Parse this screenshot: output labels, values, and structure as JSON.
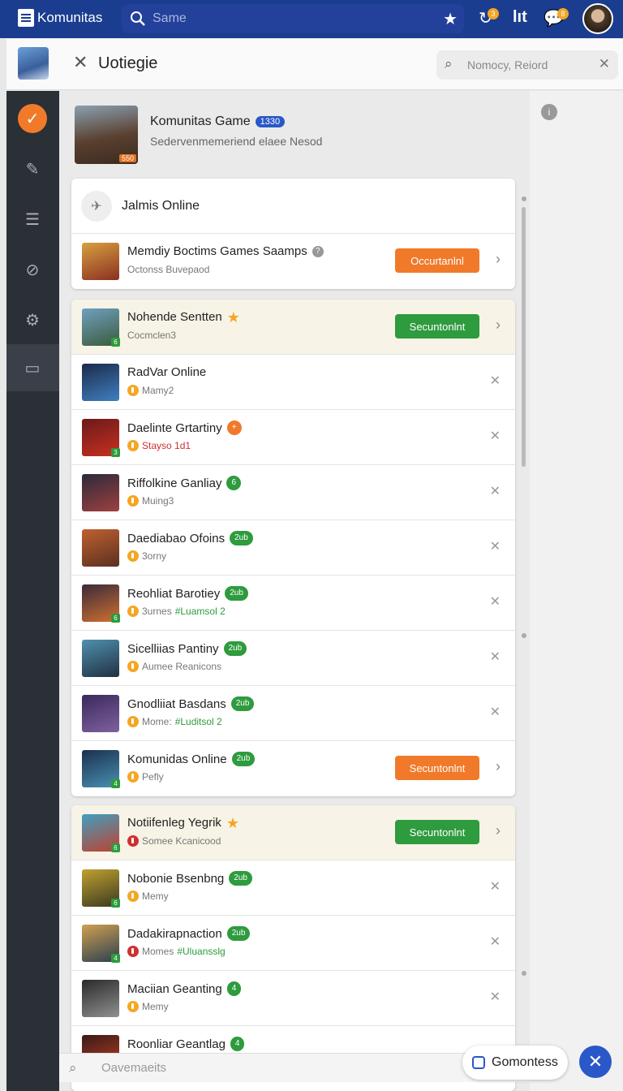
{
  "topbar": {
    "brand": "Komunitas",
    "search_placeholder": "Same",
    "badge1": "3",
    "badge2": "8"
  },
  "subbar": {
    "title": "Uotiegie",
    "search_placeholder": "Nomocy, Reiord"
  },
  "header_game": {
    "title": "Komunitas Game",
    "pill": "1330",
    "subtitle": "Sedervenmemeriend elaee Nesod",
    "num": "550"
  },
  "card1": {
    "header": "Jalmis Online",
    "rows": [
      {
        "title": "Memdiy Boctims Games Saamps",
        "sub": "Octonss Buvepaod",
        "action": "Occurtanlnl",
        "colors": [
          "#d8a040",
          "#8a3020"
        ]
      }
    ]
  },
  "card2": {
    "rows": [
      {
        "title": "Nohende Sentten",
        "tag": "★",
        "tagtype": "star",
        "sub": "Cocmclen3",
        "action": "Secuntonlnt",
        "actiontype": "g",
        "mini": "6",
        "colors": [
          "#70a0c0",
          "#3a5a3a"
        ]
      },
      {
        "title": "RadVar Online",
        "sub": "Mamy2",
        "coin": "o",
        "colors": [
          "#1a2a4a",
          "#4080c0"
        ]
      },
      {
        "title": "Daelinte Grtartiny",
        "tag": "+",
        "tagtype": "o",
        "sub": "Stayso 1d1",
        "subclass": "red",
        "coin": "o",
        "mini": "3",
        "colors": [
          "#6a1a1a",
          "#c83020"
        ]
      },
      {
        "title": "Riffolkine Ganliay",
        "tag": "6",
        "tagtype": "g",
        "sub": "Muing3",
        "coin": "o",
        "colors": [
          "#2a2a3a",
          "#a04040"
        ]
      },
      {
        "title": "Daediabao Ofoins",
        "tag": "2ub",
        "tagtype": "g",
        "sub": "3orny",
        "coin": "o",
        "colors": [
          "#c06030",
          "#5a3020"
        ]
      },
      {
        "title": "Reohliat Barotiey",
        "tag": "2ub",
        "tagtype": "g",
        "sub": "3urnes",
        "extra": "#Luamsol 2",
        "coin": "o",
        "mini": "6",
        "colors": [
          "#3a2a3a",
          "#d07030"
        ]
      },
      {
        "title": "Sicelliias Pantiny",
        "tag": "2ub",
        "tagtype": "g",
        "sub": "Aumee Reanicons",
        "coin": "o",
        "colors": [
          "#5090b0",
          "#203040"
        ]
      },
      {
        "title": "Gnodliiat Basdans",
        "tag": "2ub",
        "tagtype": "g",
        "sub": "Mome:",
        "extra": "#Luditsol 2",
        "coin": "o",
        "colors": [
          "#3a2a5a",
          "#8060a0"
        ]
      },
      {
        "title": "Komunidas Online",
        "tag": "2ub",
        "tagtype": "g",
        "sub": "Pefly",
        "coin": "o",
        "action": "Secuntonlnt",
        "actiontype": "o",
        "mini": "4",
        "colors": [
          "#1a3050",
          "#4a90b0"
        ]
      }
    ]
  },
  "card3": {
    "rows": [
      {
        "title": "Notiifenleg Yegrik",
        "tag": "★",
        "tagtype": "star",
        "sub": "Somee Kcanicood",
        "coin": "r",
        "action": "Secuntonlnt",
        "actiontype": "g",
        "mini": "6",
        "colors": [
          "#40a0c0",
          "#c04030"
        ]
      },
      {
        "title": "Nobonie Bsenbng",
        "tag": "2ub",
        "tagtype": "g",
        "sub": "Memy",
        "coin": "o",
        "mini": "6",
        "colors": [
          "#c0a030",
          "#3a3a20"
        ]
      },
      {
        "title": "Dadakirapnaction",
        "tag": "2ub",
        "tagtype": "g",
        "sub": "Momes",
        "extra": "#Uluansslg",
        "coin": "r",
        "mini": "4",
        "colors": [
          "#d0a050",
          "#2a4050"
        ]
      },
      {
        "title": "Maciian Geanting",
        "tag": "4",
        "tagtype": "g",
        "sub": "Memy",
        "coin": "o",
        "colors": [
          "#2a2a2a",
          "#909090"
        ]
      },
      {
        "title": "Roonliar Geantlag",
        "tag": "4",
        "tagtype": "g",
        "sub": "",
        "colors": [
          "#3a1a1a",
          "#c04020"
        ]
      }
    ]
  },
  "bottom": {
    "search_placeholder": "Oavemaeits",
    "toast": "Gomontess"
  }
}
